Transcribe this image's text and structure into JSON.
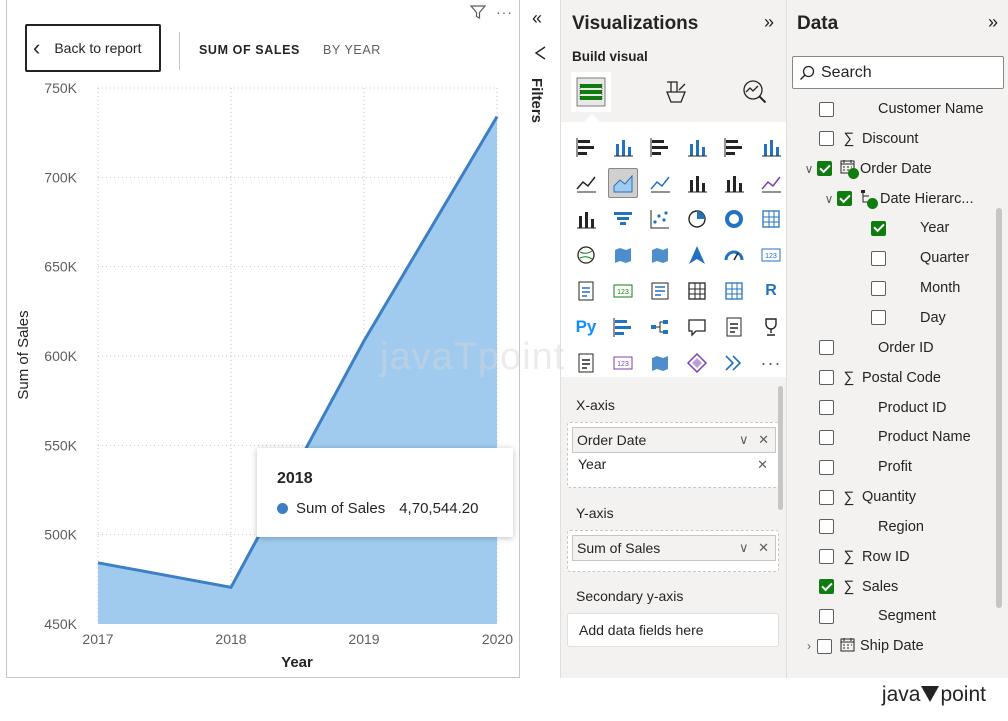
{
  "report": {
    "back_label": "Back to report",
    "breadcrumb": [
      "SUM OF SALES",
      "BY YEAR"
    ],
    "tooltip": {
      "title": "2018",
      "series": "Sum of Sales",
      "value": "4,70,544.20"
    }
  },
  "chart_data": {
    "type": "area",
    "x": [
      2017,
      2018,
      2019,
      2020
    ],
    "x_tick_labels": [
      "2017",
      "2018",
      "2019",
      "2020"
    ],
    "series": [
      {
        "values": [
          484247,
          470533,
          608473,
          733947
        ]
      }
    ],
    "ylim": [
      450000,
      750000
    ],
    "y_ticks": [
      450000,
      500000,
      550000,
      600000,
      650000,
      700000,
      750000
    ],
    "y_tick_labels": [
      "450K",
      "500K",
      "550K",
      "600K",
      "650K",
      "700K",
      "750K"
    ],
    "xlabel": "Year",
    "ylabel": "Sum of Sales",
    "grid": true,
    "colors": {
      "fill": "#a0cbef",
      "line": "#3d7fc4"
    }
  },
  "filters": {
    "label": "Filters"
  },
  "visualizations": {
    "title": "Visualizations",
    "build_label": "Build visual",
    "wells": {
      "x_axis": {
        "label": "X-axis",
        "field": "Order Date",
        "sub_field": "Year"
      },
      "y_axis": {
        "label": "Y-axis",
        "field": "Sum of Sales"
      },
      "secondary": {
        "label": "Secondary y-axis",
        "placeholder": "Add data fields here"
      }
    },
    "icons": [
      "stacked-bar-icon",
      "stacked-column-icon",
      "clustered-bar-icon",
      "clustered-column-icon",
      "100-stacked-bar-icon",
      "100-stacked-column-icon",
      "line-chart-icon",
      "area-chart-icon",
      "stacked-area-icon",
      "line-clustered-column-icon",
      "line-stacked-column-icon",
      "ribbon-chart-icon",
      "waterfall-chart-icon",
      "funnel-chart-icon",
      "scatter-chart-icon",
      "pie-chart-icon",
      "donut-chart-icon",
      "treemap-icon",
      "map-icon",
      "filled-map-icon",
      "shape-map-icon",
      "azure-map-icon",
      "gauge-icon",
      "card-icon",
      "multi-row-card-icon",
      "kpi-icon",
      "slicer-icon",
      "table-icon",
      "matrix-icon",
      "r-script-icon",
      "python-icon",
      "key-influencers-icon",
      "decomposition-tree-icon",
      "qa-icon",
      "smart-narrative-icon",
      "goals-icon",
      "paginated-report-icon",
      "power-apps-icon",
      "power-automate-icon",
      "diamond-visual-icon",
      "arrow-visual-icon",
      "more-visuals-icon"
    ]
  },
  "data": {
    "title": "Data",
    "search_placeholder": "Search",
    "fields": [
      {
        "label": "Customer Name",
        "icon": "none",
        "checked": false,
        "level": 0
      },
      {
        "label": "Discount",
        "icon": "sigma",
        "checked": false,
        "level": 0
      },
      {
        "label": "Order Date",
        "icon": "calendar",
        "checked": true,
        "level": 0,
        "expanded": true
      },
      {
        "label": "Date Hierarc...",
        "icon": "hierarchy",
        "checked": true,
        "level": 1,
        "expanded": true
      },
      {
        "label": "Year",
        "icon": "none",
        "checked": true,
        "level": 2
      },
      {
        "label": "Quarter",
        "icon": "none",
        "checked": false,
        "level": 2
      },
      {
        "label": "Month",
        "icon": "none",
        "checked": false,
        "level": 2
      },
      {
        "label": "Day",
        "icon": "none",
        "checked": false,
        "level": 2
      },
      {
        "label": "Order ID",
        "icon": "none",
        "checked": false,
        "level": 0
      },
      {
        "label": "Postal Code",
        "icon": "sigma",
        "checked": false,
        "level": 0
      },
      {
        "label": "Product ID",
        "icon": "none",
        "checked": false,
        "level": 0
      },
      {
        "label": "Product Name",
        "icon": "none",
        "checked": false,
        "level": 0
      },
      {
        "label": "Profit",
        "icon": "none",
        "checked": false,
        "level": 0
      },
      {
        "label": "Quantity",
        "icon": "sigma",
        "checked": false,
        "level": 0
      },
      {
        "label": "Region",
        "icon": "none",
        "checked": false,
        "level": 0
      },
      {
        "label": "Row ID",
        "icon": "sigma",
        "checked": false,
        "level": 0
      },
      {
        "label": "Sales",
        "icon": "sigma",
        "checked": true,
        "level": 0
      },
      {
        "label": "Segment",
        "icon": "none",
        "checked": false,
        "level": 0
      },
      {
        "label": "Ship Date",
        "icon": "calendar",
        "checked": false,
        "level": 0,
        "expanded": false
      }
    ]
  },
  "watermark": {
    "center": "javaTpoint",
    "brand_left": "java",
    "brand_right": "point"
  }
}
